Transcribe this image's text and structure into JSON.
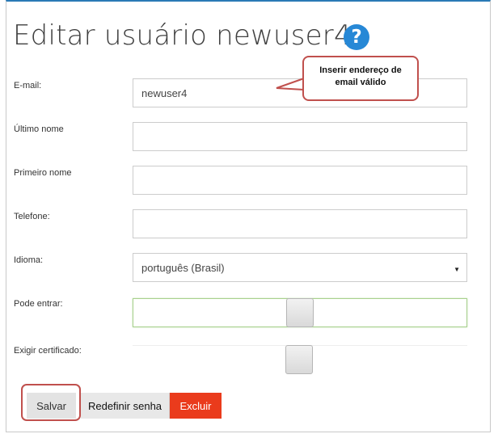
{
  "page": {
    "title": "Editar usuário newuser4:",
    "help_icon": "question-circle-icon",
    "accent_color": "#2788d6"
  },
  "form": {
    "email": {
      "label": "E-mail:",
      "value": "newuser4"
    },
    "last_name": {
      "label": "Último nome",
      "value": ""
    },
    "first_name": {
      "label": "Primeiro nome",
      "value": ""
    },
    "phone": {
      "label": "Telefone:",
      "value": ""
    },
    "language": {
      "label": "Idioma:",
      "value": "português (Brasil)"
    },
    "can_login": {
      "label": "Pode entrar:"
    },
    "require_certificate": {
      "label": "Exigir certificado:"
    }
  },
  "buttons": {
    "save": "Salvar",
    "reset_password": "Redefinir senha",
    "delete": "Excluir",
    "delete_color": "#ea3b1c"
  },
  "annotation": {
    "callout_line1": "Inserir endereço de",
    "callout_line2": "email válido",
    "highlight_color": "#c0504d"
  }
}
